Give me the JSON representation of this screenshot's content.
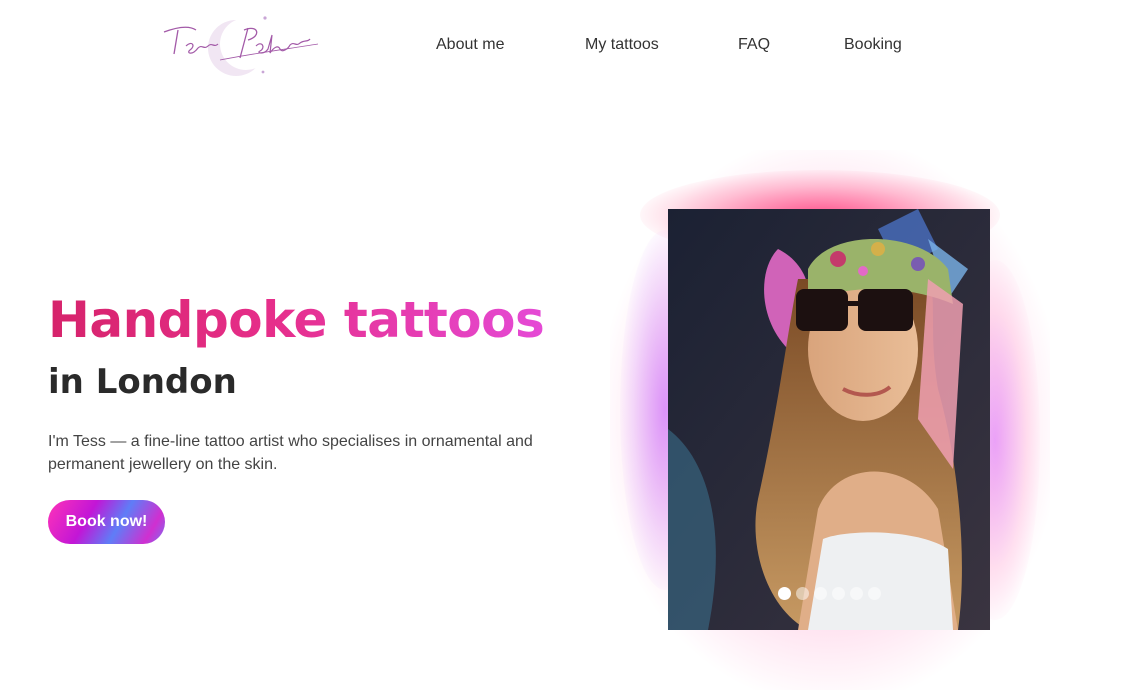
{
  "brand": {
    "logo_text": "Tess Pokes"
  },
  "nav": {
    "items": [
      {
        "label": "About me"
      },
      {
        "label": "My tattoos"
      },
      {
        "label": "FAQ"
      },
      {
        "label": "Booking"
      }
    ]
  },
  "hero": {
    "title": "Handpoke tattoos",
    "subtitle": "in London",
    "description": "I'm Tess — a fine-line tattoo artist who specialises in ornamental and permanent jewellery on the skin.",
    "cta_label": "Book now!"
  },
  "carousel": {
    "slide_count": 6,
    "active_index": 0
  },
  "colors": {
    "title_gradient_start": "#d6236b",
    "title_gradient_end": "#e54ad6",
    "text_dark": "#2a2a2a"
  }
}
